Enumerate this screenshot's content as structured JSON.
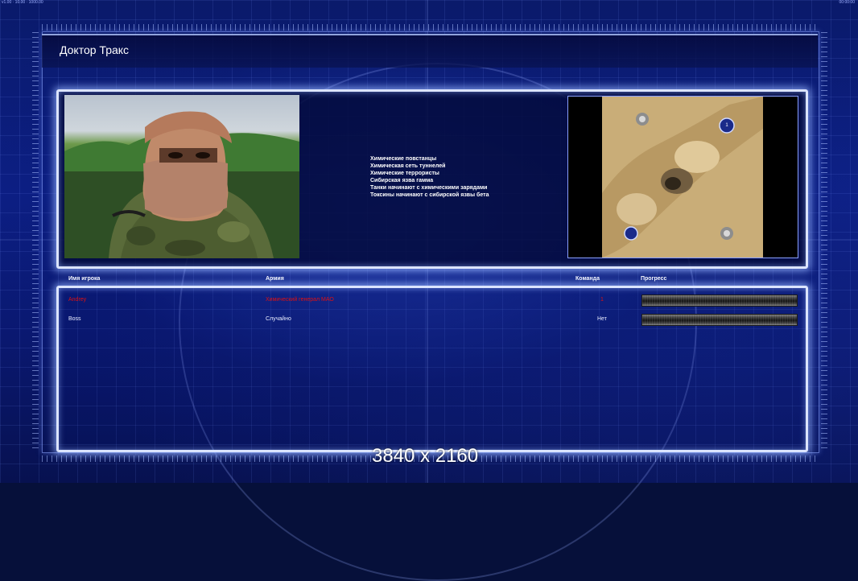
{
  "topbar": {
    "left_text": "v1.00 · 10.00 · 1000.00",
    "right_text": "00:00:00"
  },
  "title": "Доктор Тракс",
  "scenario_details": [
    "Химические повстанцы",
    "Химическая сеть туннелей",
    "Химические террористы",
    "Сибирская язва гамма",
    "Танки начинают с химическими зарядами",
    "Токсины начинают с сибирской язвы бета"
  ],
  "map": {
    "player_marker_1": "1"
  },
  "table": {
    "headers": {
      "player": "Имя игрока",
      "army": "Армия",
      "team": "Команда",
      "progress": "Прогресс"
    },
    "rows": [
      {
        "player": "Andrey",
        "army": "Химический генерал МАО",
        "team": "1",
        "active": true
      },
      {
        "player": "Boss",
        "army": "Случайно",
        "team": "Нет",
        "active": false
      }
    ]
  },
  "resolution_label": "3840 x 2160",
  "colors": {
    "panel_glow": "#dbe4ff",
    "active_player_text": "#e01010",
    "background": "#0c1f86"
  }
}
